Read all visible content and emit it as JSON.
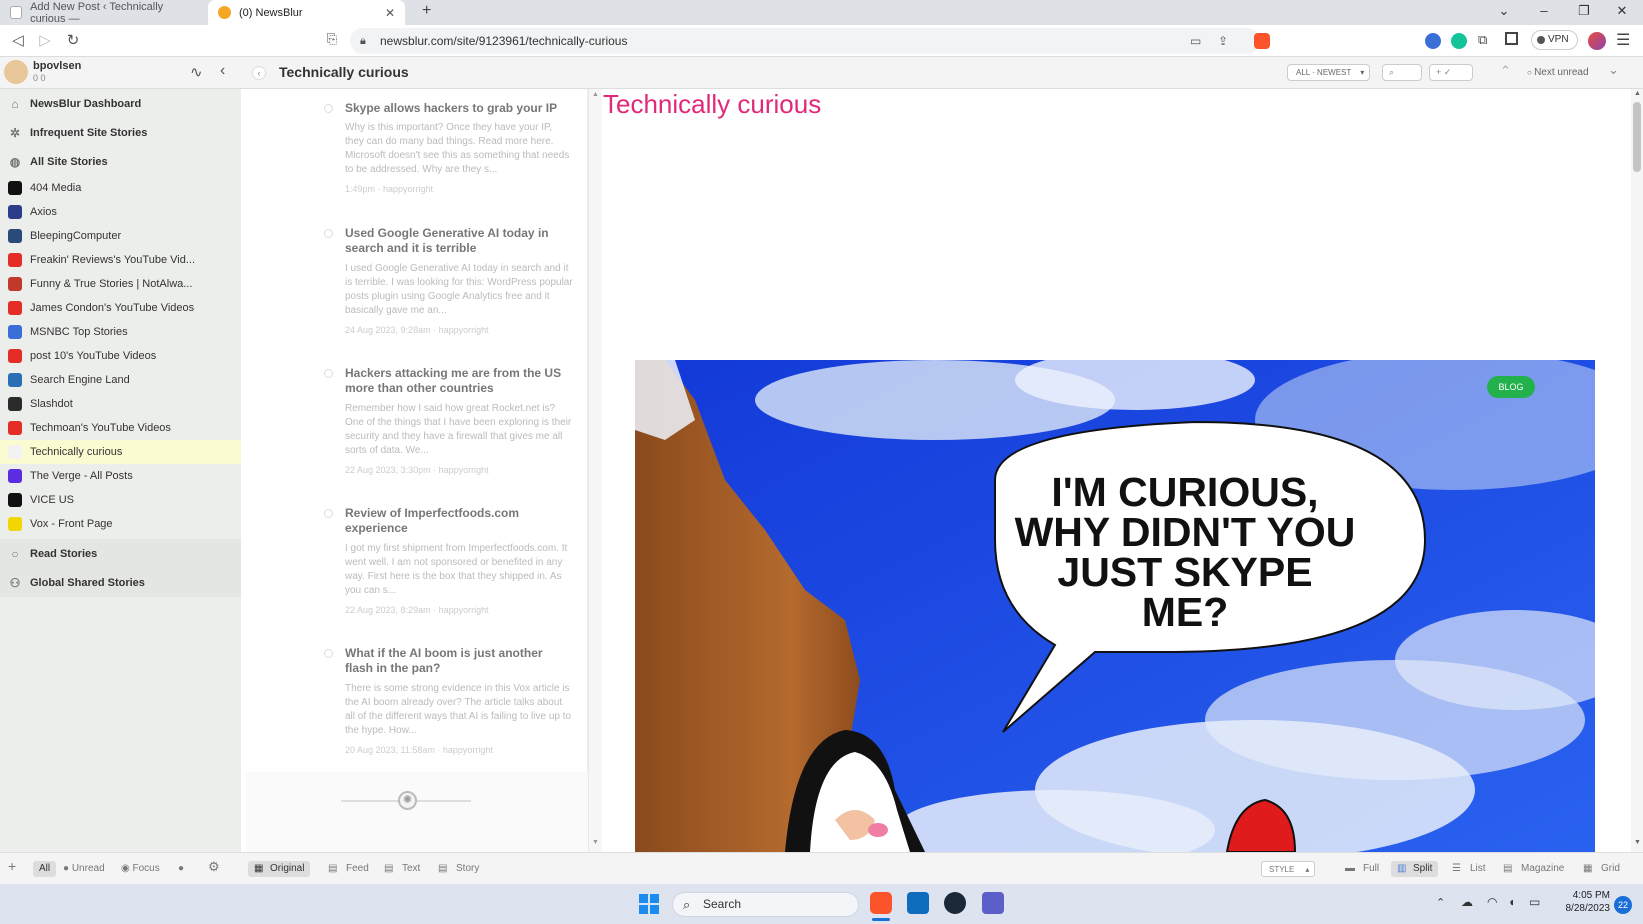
{
  "browser": {
    "tabs": [
      {
        "title": "Add New Post ‹ Technically curious —"
      },
      {
        "title": "(0) NewsBlur"
      }
    ],
    "url": "newsblur.com/site/9123961/technically-curious",
    "vpn_label": "VPN"
  },
  "user": {
    "name": "bpovlsen",
    "counts": "0   0"
  },
  "header": {
    "feed_title": "Technically curious",
    "order_label": "ALL · NEWEST",
    "next_unread": "Next unread"
  },
  "sidebar": {
    "top_items": [
      {
        "label": "NewsBlur Dashboard",
        "icon": "home-icon"
      },
      {
        "label": "Infrequent Site Stories",
        "icon": "gear-icon"
      },
      {
        "label": "All Site Stories",
        "icon": "globe-icon"
      }
    ],
    "feeds": [
      {
        "label": "404 Media",
        "color": "#111111"
      },
      {
        "label": "Axios",
        "color": "#2c3e8a"
      },
      {
        "label": "BleepingComputer",
        "color": "#2a4a7a"
      },
      {
        "label": "Freakin' Reviews's YouTube Vid...",
        "color": "#e52d27"
      },
      {
        "label": "Funny & True Stories | NotAlwa...",
        "color": "#c0392b"
      },
      {
        "label": "James Condon's YouTube Videos",
        "color": "#e52d27"
      },
      {
        "label": "MSNBC Top Stories",
        "color": "#3a6fd8"
      },
      {
        "label": "post 10's YouTube Videos",
        "color": "#e52d27"
      },
      {
        "label": "Search Engine Land",
        "color": "#2a6fb5"
      },
      {
        "label": "Slashdot",
        "color": "#2b2b2b"
      },
      {
        "label": "Techmoan's YouTube Videos",
        "color": "#e52d27"
      },
      {
        "label": "Technically curious",
        "color": "#f2f2f2"
      },
      {
        "label": "The Verge - All Posts",
        "color": "#5a2ee0"
      },
      {
        "label": "VICE US",
        "color": "#111111"
      },
      {
        "label": "Vox - Front Page",
        "color": "#f2d600"
      }
    ],
    "bottom_items": [
      {
        "label": "Read Stories",
        "icon": "circle-icon"
      },
      {
        "label": "Global Shared Stories",
        "icon": "share-icon"
      }
    ]
  },
  "stories": [
    {
      "title": "Skype allows hackers to grab your IP",
      "snippet": "Why is this important? Once they have your IP, they can do many bad things. Read more here. Microsoft doesn't see this as something that needs to be addressed. Why are they s...",
      "meta": "1:49pm · happyorright"
    },
    {
      "title": "Used Google Generative AI today in search and it is terrible",
      "snippet": "I used Google Generative AI today in search and it is terrible. I was looking for this: WordPress popular posts plugin using Google Analytics free and it basically gave me an...",
      "meta": "24 Aug 2023, 9:28am · happyorright"
    },
    {
      "title": "Hackers attacking me are from the US more than other countries",
      "snippet": "Remember how I said how great Rocket.net is? One of the things that I have been exploring is their security and they have a firewall that gives me all sorts of data. We...",
      "meta": "22 Aug 2023, 3:30pm · happyorright"
    },
    {
      "title": "Review of Imperfectfoods.com experience",
      "snippet": "I got my first shipment from Imperfectfoods.com. It went well. I am not sponsored or benefited in any way. First here is the box that they shipped in. As you can s...",
      "meta": "22 Aug 2023, 8:29am · happyorright"
    },
    {
      "title": "What if the AI boom is just another flash in the pan?",
      "snippet": "There is some strong evidence in this Vox article is the AI boom already over? The article talks about all of the different ways that AI is failing to live up to the hype. How...",
      "meta": "20 Aug 2023, 11:58am · happyorright"
    }
  ],
  "pane": {
    "site_title": "Technically curious",
    "badge": "BLOG",
    "speech_lines": [
      "I'M CURIOUS,",
      "WHY DIDN'T YOU",
      "JUST SKYPE",
      "ME?"
    ]
  },
  "bottombar": {
    "filters": [
      "All",
      "Unread",
      "Focus"
    ],
    "views": [
      "Original",
      "Feed",
      "Text",
      "Story"
    ],
    "style": "STYLE",
    "layouts": [
      "Full",
      "Split",
      "List",
      "Magazine",
      "Grid"
    ]
  },
  "taskbar": {
    "search": "Search",
    "time": "4:05 PM",
    "date": "8/28/2023",
    "notif": "22"
  },
  "colors": {
    "title_pink": "#e1287a",
    "selected_feed": "#fbfbd2",
    "sky": "#1d4fe6",
    "blog_badge": "#22b14c"
  }
}
